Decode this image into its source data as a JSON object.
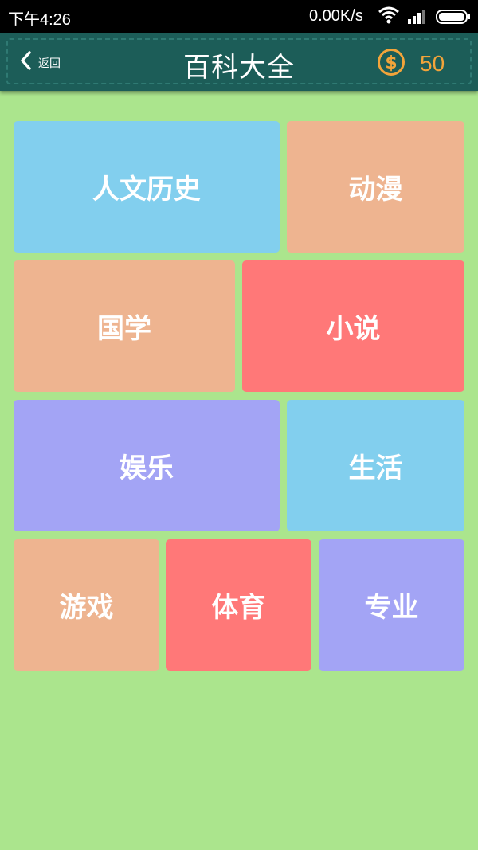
{
  "status_bar": {
    "time": "下午4:26",
    "network_rate": "0.00K/s"
  },
  "header": {
    "back_label": "返回",
    "title": "百科大全",
    "coin_count": "50"
  },
  "categories": [
    {
      "label": "人文历史",
      "color": "#82cfee"
    },
    {
      "label": "动漫",
      "color": "#eeb490"
    },
    {
      "label": "国学",
      "color": "#eeb490"
    },
    {
      "label": "小说",
      "color": "#ff7878"
    },
    {
      "label": "娱乐",
      "color": "#a3a4f5"
    },
    {
      "label": "生活",
      "color": "#82cfee"
    },
    {
      "label": "游戏",
      "color": "#eeb490"
    },
    {
      "label": "体育",
      "color": "#ff7878"
    },
    {
      "label": "专业",
      "color": "#a3a4f5"
    }
  ],
  "colors": {
    "background": "#abe58d",
    "header": "#1c5d58",
    "coin": "#f2a43a"
  }
}
